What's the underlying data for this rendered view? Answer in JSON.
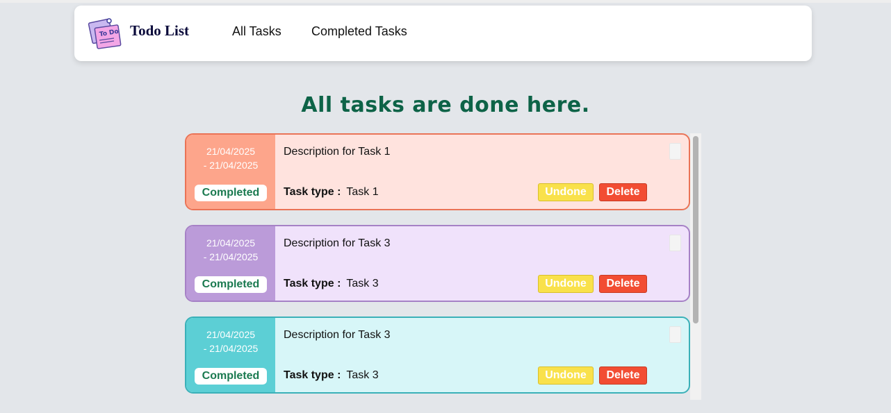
{
  "navbar": {
    "brand": "Todo List",
    "logo_icon": "todo-note-icon",
    "links": [
      "All Tasks",
      "Completed Tasks"
    ]
  },
  "heading": "All tasks are done here.",
  "tasks": [
    {
      "date_start": "21/04/2025",
      "date_end": "- 21/04/2025",
      "status": "Completed",
      "description": "Description for Task 1",
      "type_label": "Task type :",
      "type_value": "Task 1",
      "undone_label": "Undone",
      "delete_label": "Delete",
      "color_left": "#fda58b",
      "color_body": "#ffe3de",
      "color_border": "#ea7356"
    },
    {
      "date_start": "21/04/2025",
      "date_end": "- 21/04/2025",
      "status": "Completed",
      "description": "Description for Task 3",
      "type_label": "Task type :",
      "type_value": "Task 3",
      "undone_label": "Undone",
      "delete_label": "Delete",
      "color_left": "#bb9bd9",
      "color_body": "#f0e2fb",
      "color_border": "#a681c6"
    },
    {
      "date_start": "21/04/2025",
      "date_end": "- 21/04/2025",
      "status": "Completed",
      "description": "Description for Task 3",
      "type_label": "Task type :",
      "type_value": "Task 3",
      "undone_label": "Undone",
      "delete_label": "Delete",
      "color_left": "#5ccfd5",
      "color_body": "#d7f6f8",
      "color_border": "#3ab0b8"
    }
  ],
  "colors": {
    "heading": "#0d6347",
    "badge_text": "#1b7a50",
    "undone_button": "#f9e14b",
    "delete_button": "#f24d33"
  }
}
